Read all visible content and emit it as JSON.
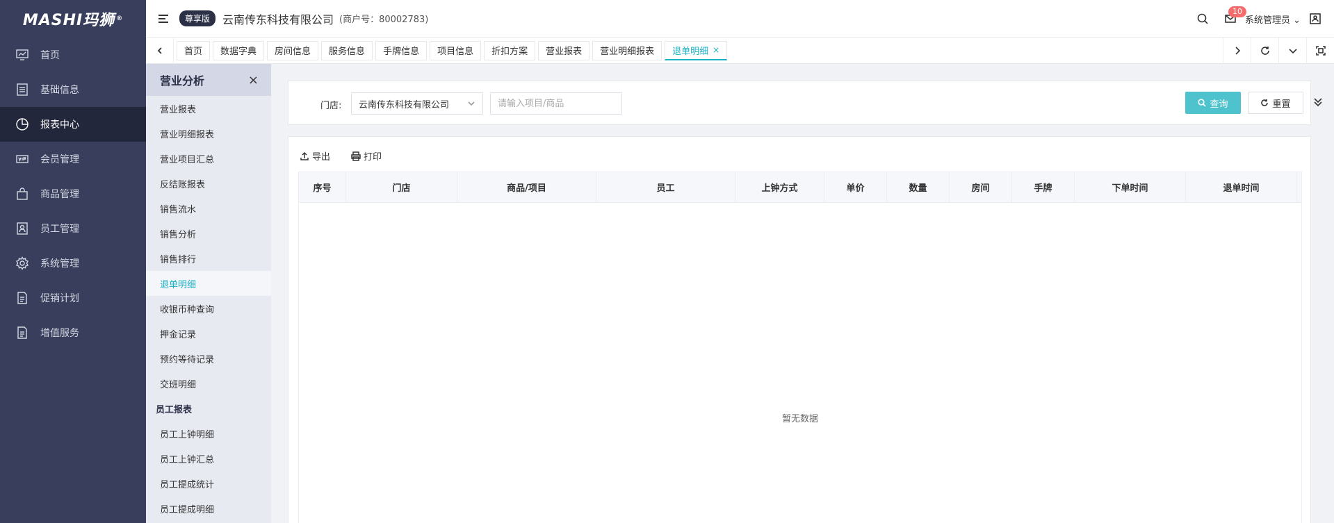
{
  "app": {
    "logo_text": "MASHI玛狮",
    "logo_mark": "®"
  },
  "sidebar": {
    "items": [
      {
        "label": "首页",
        "icon": "dashboard-icon"
      },
      {
        "label": "基础信息",
        "icon": "list-icon"
      },
      {
        "label": "报表中心",
        "icon": "pie-chart-icon"
      },
      {
        "label": "会员管理",
        "icon": "vip-icon"
      },
      {
        "label": "商品管理",
        "icon": "bag-icon"
      },
      {
        "label": "员工管理",
        "icon": "id-card-icon"
      },
      {
        "label": "系统管理",
        "icon": "gear-icon"
      },
      {
        "label": "促销计划",
        "icon": "document-icon"
      },
      {
        "label": "增值服务",
        "icon": "document-icon"
      }
    ],
    "active_index": 2
  },
  "header": {
    "edition": "尊享版",
    "company": "云南传东科技有限公司",
    "merchant": "(商户号：80002783)",
    "badge_count": "10",
    "user": "系统管理员"
  },
  "tabs": {
    "items": [
      "首页",
      "数据字典",
      "房间信息",
      "服务信息",
      "手牌信息",
      "项目信息",
      "折扣方案",
      "营业报表",
      "营业明细报表",
      "退单明细"
    ],
    "active_close": "×"
  },
  "subnav": {
    "title": "营业分析",
    "close": "×",
    "group1": [
      "营业报表",
      "营业明细报表",
      "营业项目汇总",
      "反结账报表",
      "销售流水",
      "销售分析",
      "销售排行",
      "退单明细",
      "收银币种查询",
      "押金记录",
      "预约等待记录",
      "交班明细"
    ],
    "group2_title": "员工报表",
    "group2": [
      "员工上钟明细",
      "员工上钟汇总",
      "员工提成统计",
      "员工提成明细"
    ]
  },
  "filter": {
    "store_label": "门店:",
    "store_value": "云南传东科技有限公司",
    "search_placeholder": "请输入项目/商品",
    "query_label": "查询",
    "reset_label": "重置"
  },
  "toolbar": {
    "export_label": "导出",
    "print_label": "打印"
  },
  "table": {
    "columns": [
      "序号",
      "门店",
      "商品/项目",
      "员工",
      "上钟方式",
      "单价",
      "数量",
      "房间",
      "手牌",
      "下单时间",
      "退单时间"
    ],
    "empty_text": "暂无数据"
  },
  "colors": {
    "sidebar_bg": "#383e5b",
    "accent": "#1ab0c4",
    "query_button": "#4ec3cd",
    "badge": "#f56c6c"
  }
}
